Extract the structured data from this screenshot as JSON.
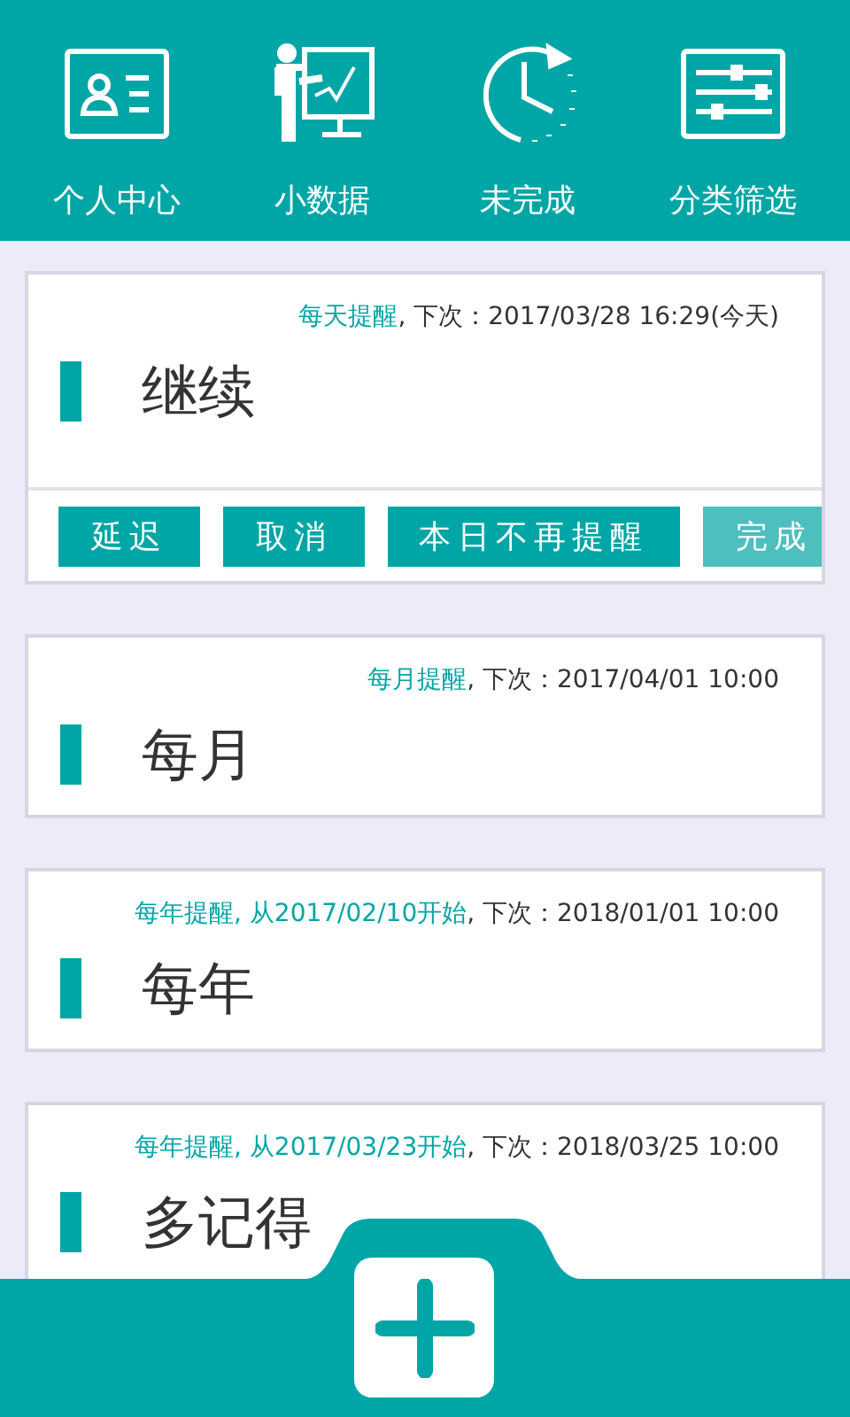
{
  "nav": [
    {
      "label": "个人中心"
    },
    {
      "label": "小数据"
    },
    {
      "label": "未完成"
    },
    {
      "label": "分类筛选"
    }
  ],
  "reminders": [
    {
      "repeat": "每天提醒",
      "next": ", 下次：2017/03/28 16:29(今天)",
      "title": "继续",
      "actions": [
        {
          "label": "延迟",
          "dimmed": false
        },
        {
          "label": "取消",
          "dimmed": false
        },
        {
          "label": "本日不再提醒",
          "dimmed": false
        },
        {
          "label": "完成",
          "dimmed": true
        }
      ]
    },
    {
      "repeat": "每月提醒",
      "next": ", 下次：2017/04/01 10:00",
      "title": "每月"
    },
    {
      "repeat": "每年提醒, 从2017/02/10开始",
      "next": ", 下次：2018/01/01 10:00",
      "title": "每年"
    },
    {
      "repeat": "每年提醒, 从2017/03/23开始",
      "next": ", 下次：2018/03/25 10:00",
      "title": "多记得"
    }
  ]
}
